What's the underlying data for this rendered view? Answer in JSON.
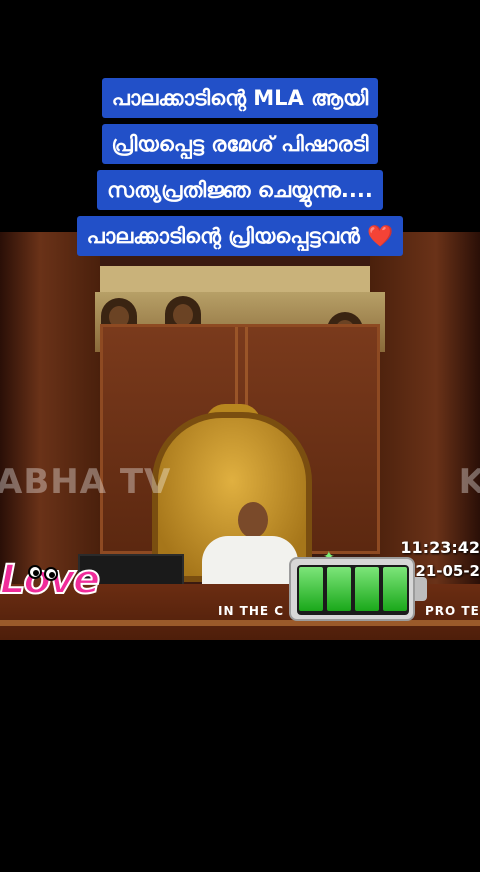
{
  "caption": {
    "lines": [
      "പാലക്കാടിന്റെ MLA ആയി",
      "പ്രിയപ്പെട്ട രമേശ് പിഷാരടി",
      "സത്യപ്രതിജ്ഞ ചെയ്യുന്നു....",
      "പാലക്കാടിന്റെ പ്രിയപ്പെട്ടവൻ"
    ],
    "heart": "❤️",
    "background_color": "#2250c8"
  },
  "video": {
    "watermark_left": "ABHA TV",
    "watermark_right": "K",
    "clock": "11:23:42",
    "date": "21-05-2",
    "ticker_left": "IN THE C",
    "ticker_right": "PRO TE"
  },
  "stickers": {
    "love_text": "Love",
    "love_color": "#f02c9a",
    "battery_level": 1.0,
    "battery_color": "#1aa81a"
  }
}
